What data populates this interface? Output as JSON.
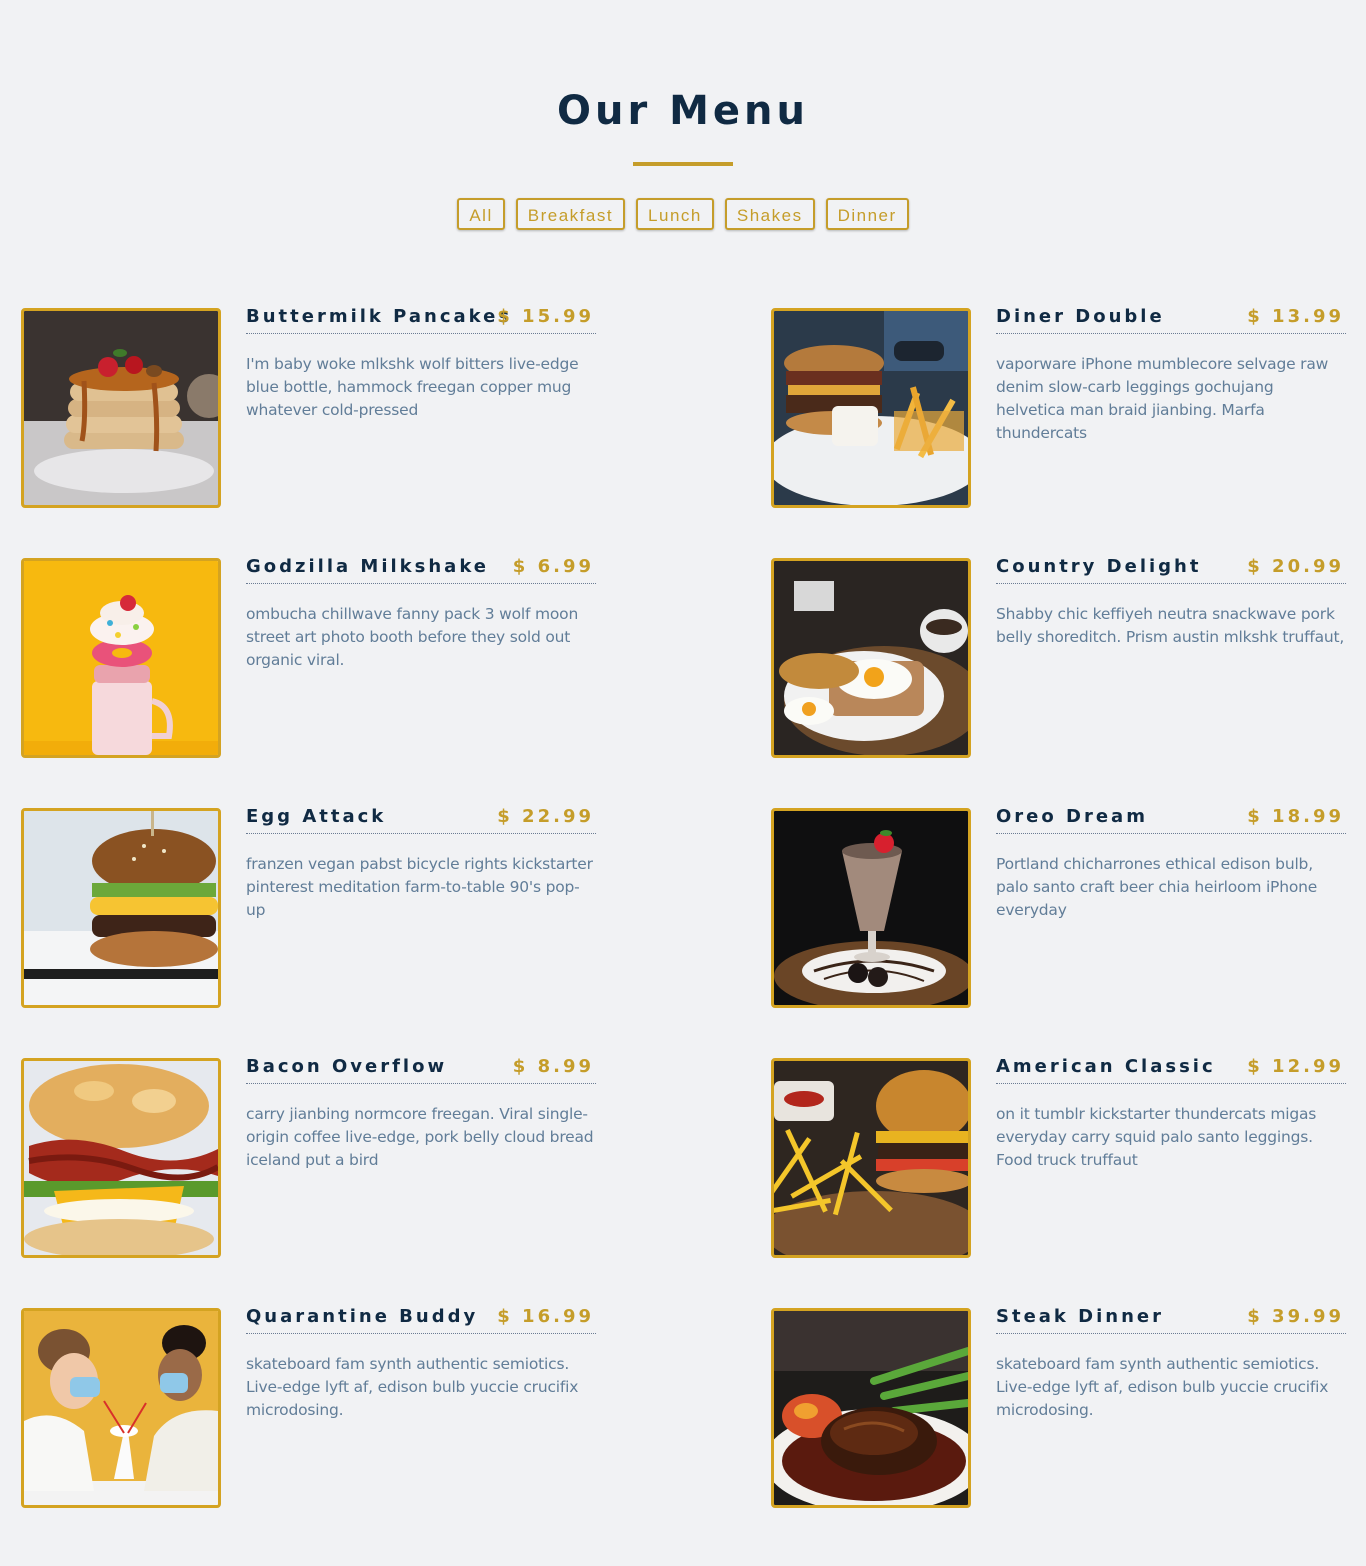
{
  "page": {
    "title": "Our Menu"
  },
  "filters": [
    "All",
    "Breakfast",
    "Lunch",
    "Shakes",
    "Dinner"
  ],
  "colors": {
    "background": "#f1f2f4",
    "accent": "#c59d2a",
    "heading": "#102a43",
    "body_text": "#617d98"
  },
  "menu": [
    {
      "name": "Buttermilk Pancakes",
      "price": "$ 15.99",
      "desc": "I'm baby woke mlkshk wolf bitters live-edge blue bottle, hammock freegan copper mug whatever cold-pressed",
      "image": "pancakes-photo"
    },
    {
      "name": "Diner Double",
      "price": "$ 13.99",
      "desc": "vaporware iPhone mumblecore selvage raw denim slow-carb leggings gochujang helvetica man braid jianbing. Marfa thundercats",
      "image": "burger-fries-photo"
    },
    {
      "name": "Godzilla Milkshake",
      "price": "$ 6.99",
      "desc": "ombucha chillwave fanny pack 3 wolf moon street art photo booth before they sold out organic viral.",
      "image": "milkshake-photo"
    },
    {
      "name": "Country Delight",
      "price": "$ 20.99",
      "desc": "Shabby chic keffiyeh neutra snackwave pork belly shoreditch. Prism austin mlkshk truffaut,",
      "image": "eggs-toast-photo"
    },
    {
      "name": "Egg Attack",
      "price": "$ 22.99",
      "desc": "franzen vegan pabst bicycle rights kickstarter pinterest meditation farm-to-table 90's pop-up",
      "image": "egg-burger-photo"
    },
    {
      "name": "Oreo Dream",
      "price": "$ 18.99",
      "desc": "Portland chicharrones ethical edison bulb, palo santo craft beer chia heirloom iPhone everyday",
      "image": "oreo-shake-photo"
    },
    {
      "name": "Bacon Overflow",
      "price": "$ 8.99",
      "desc": "carry jianbing normcore freegan. Viral single-origin coffee live-edge, pork belly cloud bread iceland put a bird",
      "image": "bacon-biscuit-photo"
    },
    {
      "name": "American Classic",
      "price": "$ 12.99",
      "desc": "on it tumblr kickstarter thundercats migas everyday carry squid palo santo leggings. Food truck truffaut",
      "image": "classic-burger-photo"
    },
    {
      "name": "Quarantine Buddy",
      "price": "$ 16.99",
      "desc": "skateboard fam synth authentic semiotics. Live-edge lyft af, edison bulb yuccie crucifix microdosing.",
      "image": "couple-masks-photo"
    },
    {
      "name": "Steak Dinner",
      "price": "$ 39.99",
      "desc": "skateboard fam synth authentic semiotics. Live-edge lyft af, edison bulb yuccie crucifix microdosing.",
      "image": "steak-photo"
    }
  ]
}
